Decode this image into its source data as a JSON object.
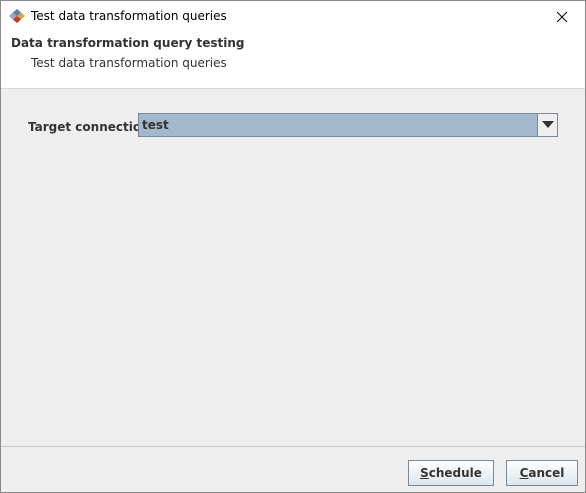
{
  "window": {
    "title": "Test data transformation queries",
    "app_icon": "app-logo-icon",
    "close_icon": "close-icon"
  },
  "header": {
    "title": "Data transformation query testing",
    "subtitle": "Test data transformation queries"
  },
  "form": {
    "target_connection_label": "Target connection:",
    "target_connection_value": "test",
    "dropdown_icon": "chevron-down-icon"
  },
  "footer": {
    "schedule_mnemonic": "S",
    "schedule_rest": "chedule",
    "cancel_mnemonic": "C",
    "cancel_rest": "ancel"
  },
  "colors": {
    "selected_combo_bg": "#a3b8cc",
    "dialog_bg": "#eeeeee",
    "header_bg": "#ffffff"
  }
}
